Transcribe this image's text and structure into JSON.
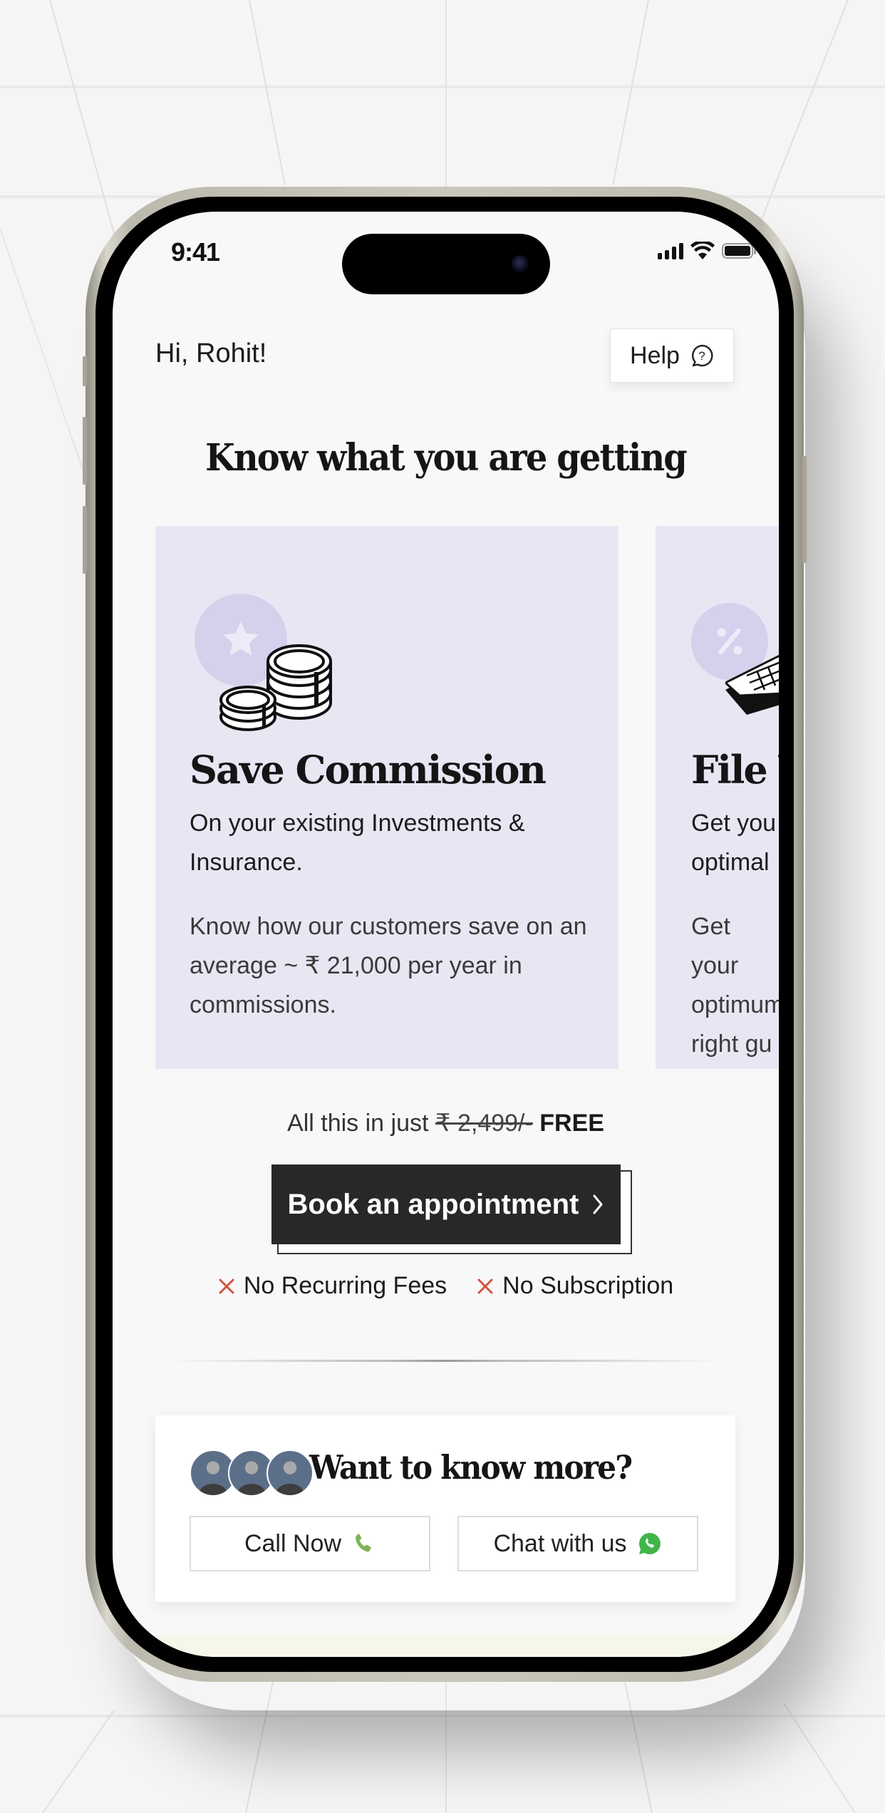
{
  "status_bar": {
    "time": "9:41"
  },
  "header": {
    "greeting": "Hi, Rohit!",
    "help_label": "Help",
    "help_icon": "question-chat-icon"
  },
  "section_title": "Know what you are getting",
  "cards": [
    {
      "icon": "coins-icon",
      "badge_icon": "star-icon",
      "title": "Save Commission",
      "subtitle": "On your existing Investments & Insurance.",
      "description": "Know how our customers save on an average ~ ₹ 21,000 per year in commissions."
    },
    {
      "icon": "calculator-icon",
      "badge_icon": "percent-icon",
      "title": "File Y",
      "subtitle": "Get you optimal",
      "description": "Get your optimum right gu"
    }
  ],
  "pricing": {
    "prefix": "All this in just",
    "original_price": "₹ 2,499/-",
    "current_price": "FREE"
  },
  "cta": {
    "label": "Book an appointment",
    "icon": "chevron-right-icon"
  },
  "perks": [
    {
      "icon": "cross-icon",
      "label": "No Recurring Fees"
    },
    {
      "icon": "cross-icon",
      "label": "No Subscription"
    }
  ],
  "contact": {
    "title": "Want to know more?",
    "avatars_count": 3,
    "call_label": "Call Now",
    "chat_label": "Chat with us"
  },
  "colors": {
    "card_bg": "#e9e6f4",
    "badge_bg": "#d5d0ec",
    "cta_bg": "#282828",
    "cross": "#d0533d",
    "phone_green": "#7fb35a",
    "whatsapp_green": "#3fb54a"
  }
}
